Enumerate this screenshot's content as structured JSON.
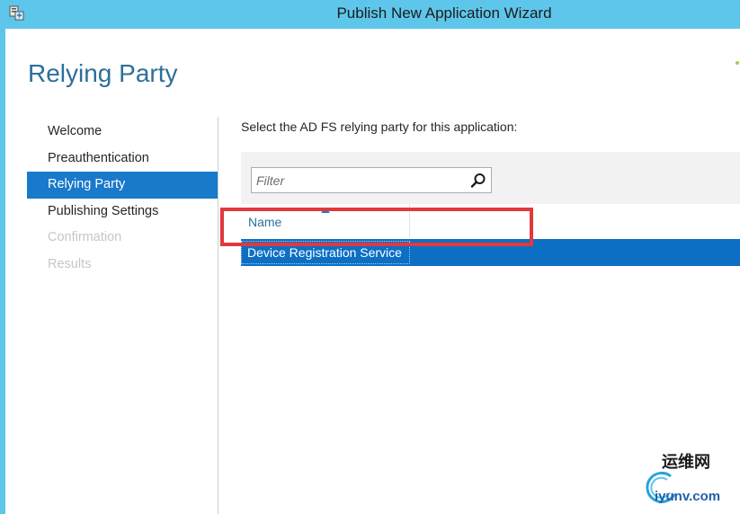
{
  "window": {
    "title": "Publish New Application Wizard",
    "titlebar_color": "#5ec6ea",
    "icon": "server-wizard-icon"
  },
  "page": {
    "title": "Relying Party"
  },
  "nav": {
    "items": [
      {
        "label": "Welcome",
        "state": "normal"
      },
      {
        "label": "Preauthentication",
        "state": "normal"
      },
      {
        "label": "Relying Party",
        "state": "active"
      },
      {
        "label": "Publishing Settings",
        "state": "normal"
      },
      {
        "label": "Confirmation",
        "state": "disabled"
      },
      {
        "label": "Results",
        "state": "disabled"
      }
    ],
    "active_color": "#1979ca"
  },
  "main": {
    "prompt": "Select the AD FS relying party for this application:",
    "filter": {
      "value": "",
      "placeholder": "Filter",
      "icon": "search-icon"
    },
    "table": {
      "columns": [
        {
          "label": "Name",
          "sort": "ascending"
        }
      ],
      "rows": [
        {
          "name": "Device Registration Service",
          "selected": true
        }
      ],
      "selected_color": "#0c6fc4"
    }
  },
  "annotation": {
    "highlight_color": "#e0393e"
  },
  "watermark": {
    "chinese": "运维网",
    "url": "iyunv.com"
  }
}
